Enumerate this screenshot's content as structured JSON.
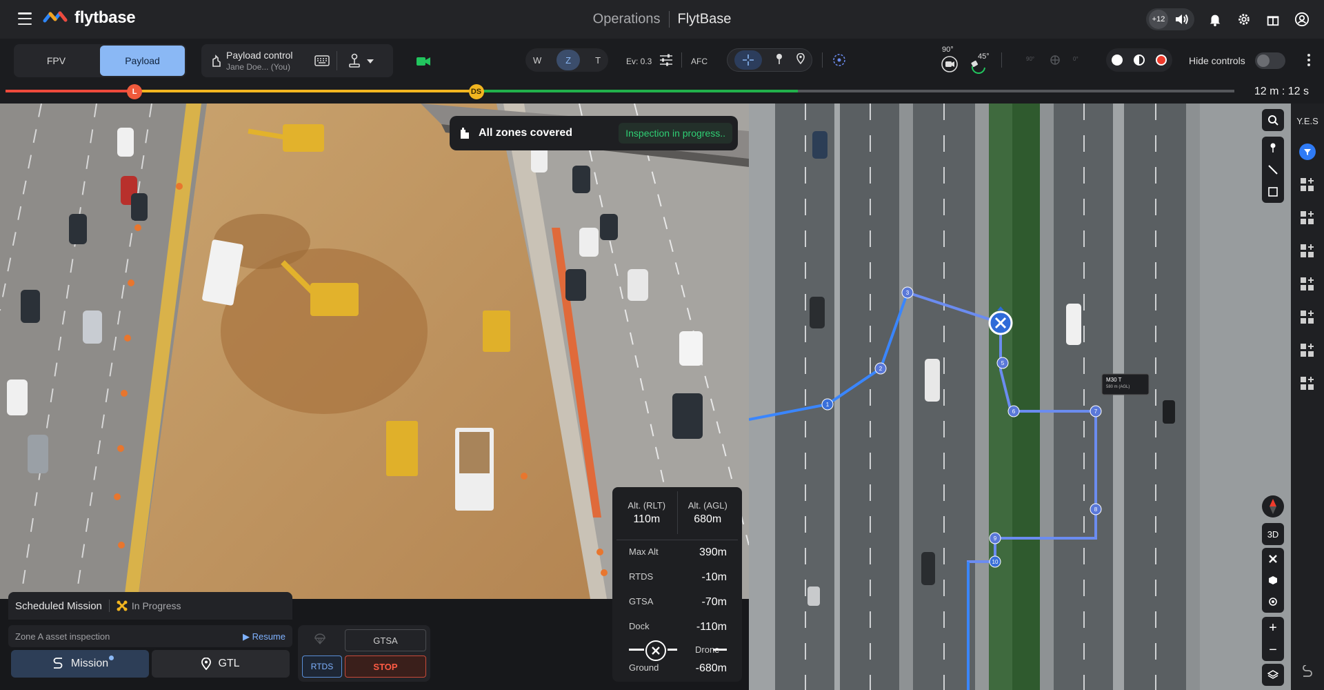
{
  "header": {
    "logo_text": "flytbase",
    "section": "Operations",
    "brand": "FlytBase",
    "notification_count": "+12"
  },
  "toolbar": {
    "view_tabs": [
      "FPV",
      "Payload"
    ],
    "active_view": "Payload",
    "payload_title": "Payload control",
    "payload_user": "Jane Doe... (You)",
    "zoom_modes": [
      "W",
      "Z",
      "T"
    ],
    "active_zoom": "Z",
    "ev_label": "Ev: 0.3",
    "afc_label": "AFC",
    "gimbal_pitch_1": "90°",
    "gimbal_pitch_2": "45°",
    "hide_controls_label": "Hide controls",
    "hide_controls_on": false
  },
  "timeline": {
    "elapsed": "12 m : 12 s",
    "markers": [
      {
        "label": "L",
        "color": "#ef5a3c",
        "pos": 0.105
      },
      {
        "label": "DS",
        "color": "#f1b520",
        "pos": 0.383
      }
    ],
    "segments": [
      {
        "color": "#ef4a3c",
        "from": 0.0,
        "to": 0.105
      },
      {
        "color": "#f1b520",
        "from": 0.105,
        "to": 0.383
      },
      {
        "color": "#22b04b",
        "from": 0.383,
        "to": 0.645
      },
      {
        "color": "#55575b",
        "from": 0.645,
        "to": 1.0
      }
    ]
  },
  "toast": {
    "title": "All zones covered",
    "status": "Inspection in progress.."
  },
  "mission": {
    "type": "Scheduled Mission",
    "status": "In Progress",
    "name": "Zone A asset inspection",
    "resume_label": "Resume",
    "mission_btn": "Mission",
    "gtl_btn": "GTL",
    "gtsa_btn": "GTSA",
    "rtds_btn": "RTDS",
    "stop_btn": "STOP"
  },
  "altitude": {
    "rlt_label": "Alt. (RLT)",
    "rlt_value": "110m",
    "agl_label": "Alt. (AGL)",
    "agl_value": "680m",
    "rows": [
      {
        "label": "Max Alt",
        "value": "390m"
      },
      {
        "label": "RTDS",
        "value": "-10m"
      },
      {
        "label": "GTSA",
        "value": "-70m"
      },
      {
        "label": "Dock",
        "value": "-110m"
      }
    ],
    "drone_label": "Drone",
    "ground_label": "Ground",
    "ground_value": "-680m"
  },
  "map": {
    "rail_label": "Y.E.S",
    "btn_3d": "3D",
    "tooltip_title": "M30 T",
    "tooltip_sub": "580 m (AGL)",
    "waypoints": [
      "1",
      "2",
      "3",
      "5",
      "6",
      "7",
      "8",
      "9",
      "10"
    ]
  },
  "colors": {
    "accent": "#8ab8f5",
    "success": "#2fcf74",
    "danger": "#ff5b44",
    "route": "#6b8cf0"
  }
}
